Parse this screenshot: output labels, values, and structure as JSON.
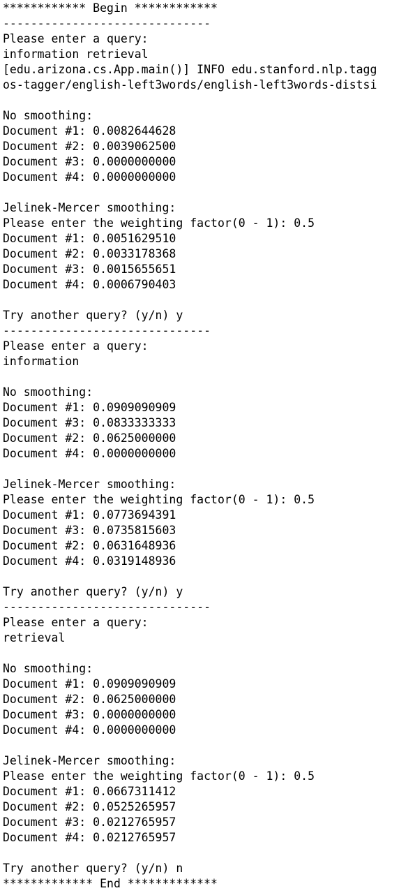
{
  "terminal": {
    "lines": [
      "************ Begin ************",
      "------------------------------",
      "Please enter a query:",
      "information retrieval",
      "[edu.arizona.cs.App.main()] INFO edu.stanford.nlp.tagg",
      "os-tagger/english-left3words/english-left3words-distsi",
      "",
      "No smoothing:",
      "Document #1: 0.0082644628",
      "Document #2: 0.0039062500",
      "Document #3: 0.0000000000",
      "Document #4: 0.0000000000",
      "",
      "Jelinek-Mercer smoothing:",
      "Please enter the weighting factor(0 - 1): 0.5",
      "Document #1: 0.0051629510",
      "Document #2: 0.0033178368",
      "Document #3: 0.0015655651",
      "Document #4: 0.0006790403",
      "",
      "Try another query? (y/n) y",
      "------------------------------",
      "Please enter a query:",
      "information",
      "",
      "No smoothing:",
      "Document #1: 0.0909090909",
      "Document #3: 0.0833333333",
      "Document #2: 0.0625000000",
      "Document #4: 0.0000000000",
      "",
      "Jelinek-Mercer smoothing:",
      "Please enter the weighting factor(0 - 1): 0.5",
      "Document #1: 0.0773694391",
      "Document #3: 0.0735815603",
      "Document #2: 0.0631648936",
      "Document #4: 0.0319148936",
      "",
      "Try another query? (y/n) y",
      "------------------------------",
      "Please enter a query:",
      "retrieval",
      "",
      "No smoothing:",
      "Document #1: 0.0909090909",
      "Document #2: 0.0625000000",
      "Document #3: 0.0000000000",
      "Document #4: 0.0000000000",
      "",
      "Jelinek-Mercer smoothing:",
      "Please enter the weighting factor(0 - 1): 0.5",
      "Document #1: 0.0667311412",
      "Document #2: 0.0525265957",
      "Document #3: 0.0212765957",
      "Document #4: 0.0212765957",
      "",
      "Try another query? (y/n) n",
      "************* End *************"
    ]
  }
}
